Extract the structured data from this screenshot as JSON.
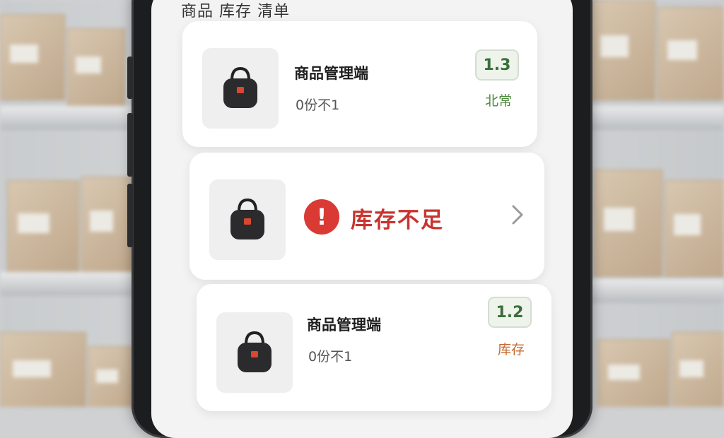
{
  "header": {
    "title": "商品 库存 清单"
  },
  "products": [
    {
      "name": "商品管理端",
      "stock": "0份不1",
      "badge": "1.3",
      "status": "北常"
    },
    {
      "alert": "库存不足"
    },
    {
      "name": "商品管理端",
      "stock": "0份不1",
      "badge": "1.2",
      "status": "库存"
    }
  ],
  "colors": {
    "alert": "#d93a34",
    "badge_text": "#3b6e3b",
    "status_green": "#4e8a3e",
    "status_orange": "#c46a2e"
  },
  "icons": {
    "product": "bag-icon",
    "alert": "exclamation-icon",
    "more": "chevron-right-icon"
  }
}
